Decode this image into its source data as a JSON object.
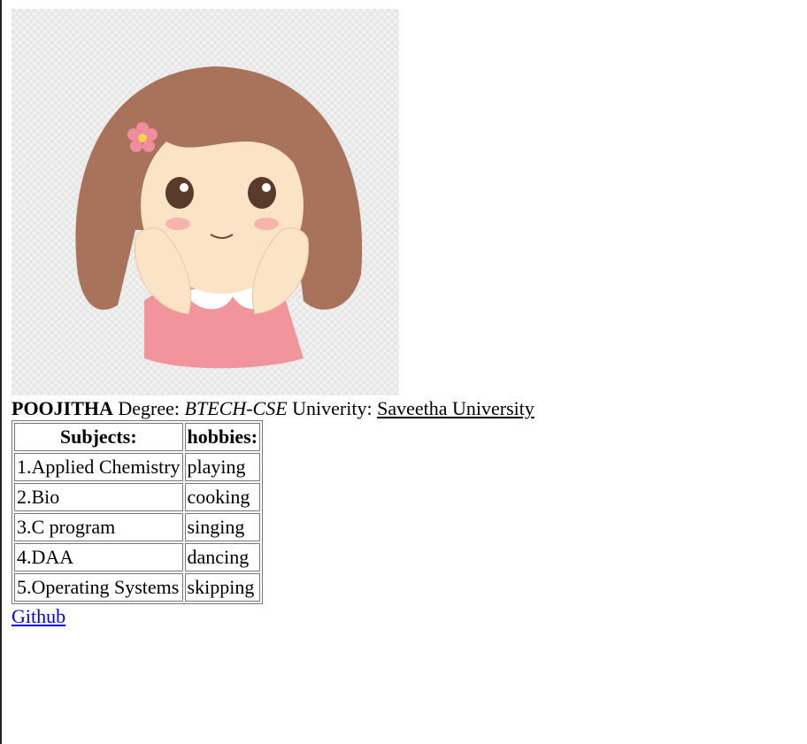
{
  "profile": {
    "name": "POOJITHA",
    "degree_label": "Degree:",
    "degree_value": "BTECH-CSE",
    "university_label": "Univerity:",
    "university_value": "Saveetha University",
    "avatar_icon": "cartoon-girl-avatar"
  },
  "table": {
    "headers": [
      "Subjects:",
      "hobbies:"
    ],
    "rows": [
      [
        "1.Applied Chemistry",
        "playing"
      ],
      [
        "2.Bio",
        "cooking"
      ],
      [
        "3.C program",
        "singing"
      ],
      [
        "4.DAA",
        "dancing"
      ],
      [
        "5.Operating Systems",
        "skipping"
      ]
    ]
  },
  "links": {
    "github_label": "Github"
  },
  "colors": {
    "link": "#0000ee",
    "text": "#000000"
  }
}
